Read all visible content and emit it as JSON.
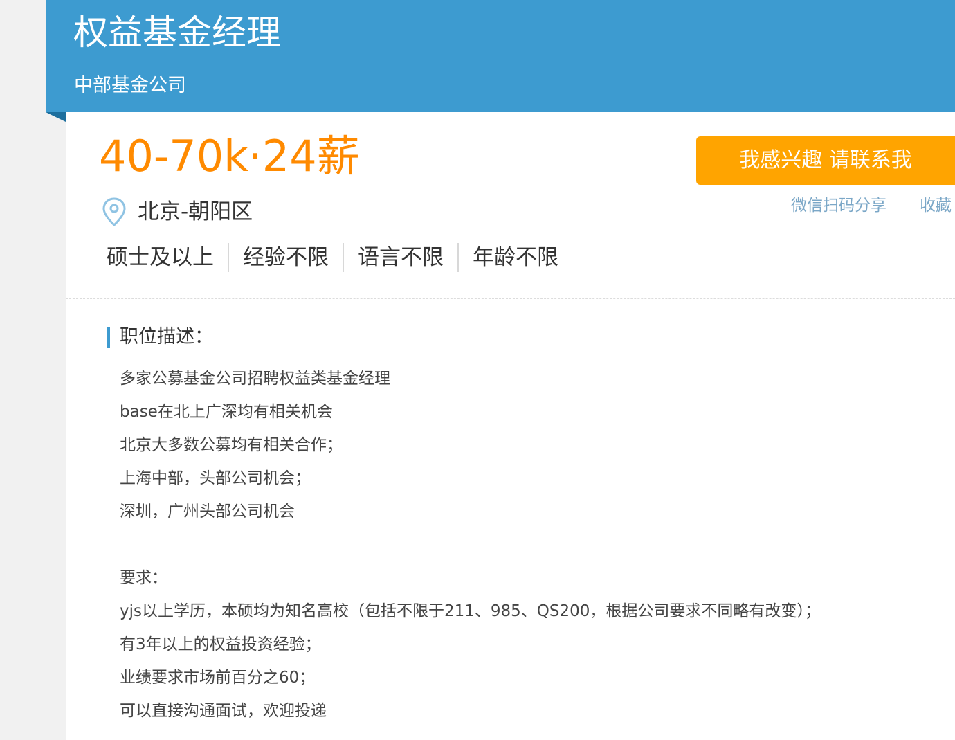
{
  "header": {
    "title": "权益基金经理",
    "company": "中部基金公司"
  },
  "job": {
    "salary": "40-70k·24薪",
    "location": "北京-朝阳区",
    "tags": [
      "硕士及以上",
      "经验不限",
      "语言不限",
      "年龄不限"
    ]
  },
  "actions": {
    "interest_label": "我感兴趣 请联系我",
    "share_label": "微信扫码分享",
    "collect_label": "收藏"
  },
  "description": {
    "heading": "职位描述：",
    "lines": [
      "多家公募基金公司招聘权益类基金经理",
      "base在北上广深均有相关机会",
      "北京大多数公募均有相关合作；",
      "上海中部，头部公司机会；",
      "深圳，广州头部公司机会",
      "",
      "要求：",
      "yjs以上学历，本硕均为知名高校（包括不限于211、985、QS200，根据公司要求不同略有改变）；",
      "有3年以上的权益投资经验；",
      "业绩要求市场前百分之60；",
      "可以直接沟通面试，欢迎投递"
    ]
  },
  "colors": {
    "header_bg": "#3d9bd0",
    "salary": "#ff8a00",
    "button_bg": "#ffa400",
    "link": "#7ba7c7"
  },
  "icons": {
    "location": "map-pin-icon"
  }
}
